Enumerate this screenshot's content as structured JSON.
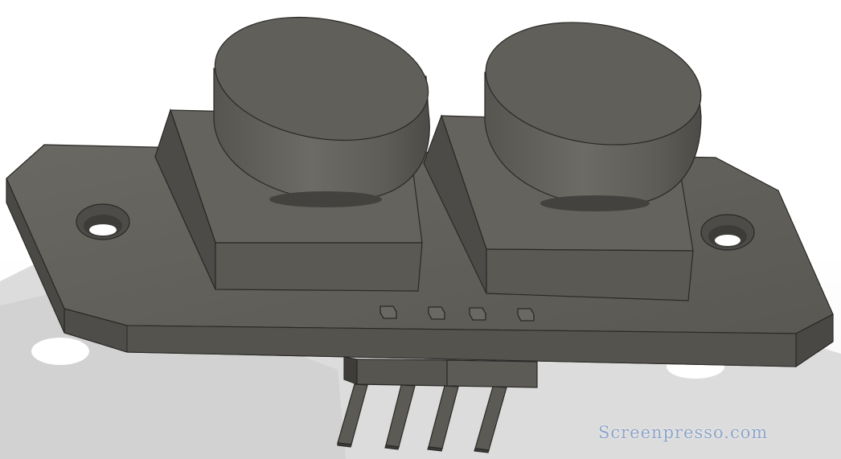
{
  "viewport": {
    "background": "#ffffff",
    "model_color": "#5f5d57",
    "shadow_color": "#d8d8d8"
  },
  "model": {
    "parts": [
      "pcb-board",
      "left-transducer",
      "right-transducer",
      "mounting-hole-left",
      "mounting-hole-right",
      "pin-header",
      "pin-1",
      "pin-2",
      "pin-3",
      "pin-4"
    ]
  },
  "watermark": {
    "text": "Screenpresso.com"
  }
}
